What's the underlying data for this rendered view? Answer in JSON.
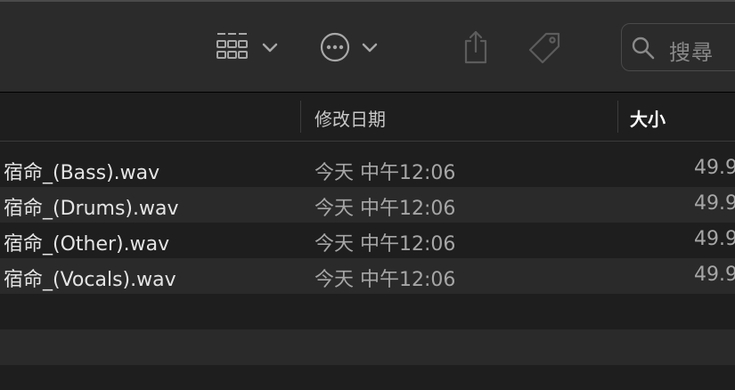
{
  "toolbar": {
    "view_icon": "grid-view-icon",
    "view_chevron": "chevron-down-icon",
    "action_icon": "ellipsis-circle-icon",
    "action_chevron": "chevron-down-icon",
    "share_icon": "share-icon",
    "tag_icon": "tag-icon",
    "search": {
      "icon": "search-icon",
      "placeholder": "搜尋"
    }
  },
  "columns": {
    "date": "修改日期",
    "size": "大小"
  },
  "files": [
    {
      "name": "宿命_(Bass).wav",
      "date": "今天 中午12:06",
      "size": "49.9"
    },
    {
      "name": "宿命_(Drums).wav",
      "date": "今天 中午12:06",
      "size": "49.9"
    },
    {
      "name": "宿命_(Other).wav",
      "date": "今天 中午12:06",
      "size": "49.9"
    },
    {
      "name": "宿命_(Vocals).wav",
      "date": "今天 中午12:06",
      "size": "49.9"
    }
  ],
  "colors": {
    "toolbar_bg": "#2b2b2b",
    "list_bg": "#1e1e1e",
    "row_alt_bg": "#2a2a2a",
    "text_primary": "#e4e4e4",
    "text_secondary": "#a6a6a6"
  }
}
